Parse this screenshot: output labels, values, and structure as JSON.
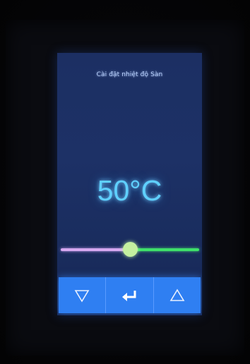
{
  "screen": {
    "title": "Cài đặt nhiệt độ Sàn",
    "temperature": "50°C"
  },
  "slider": {
    "fraction": 0.5,
    "left_color": "#d6a8f0",
    "right_color": "#3ee26a",
    "thumb_color": "#c4f0a0"
  },
  "buttons": [
    {
      "icon": "triangle-down-icon"
    },
    {
      "icon": "enter-arrow-icon"
    },
    {
      "icon": "triangle-up-icon"
    }
  ],
  "colors": {
    "screen_bg": "#1d3166",
    "button_bar": "#2f7ff2",
    "temperature_text": "#5fd0ff"
  }
}
